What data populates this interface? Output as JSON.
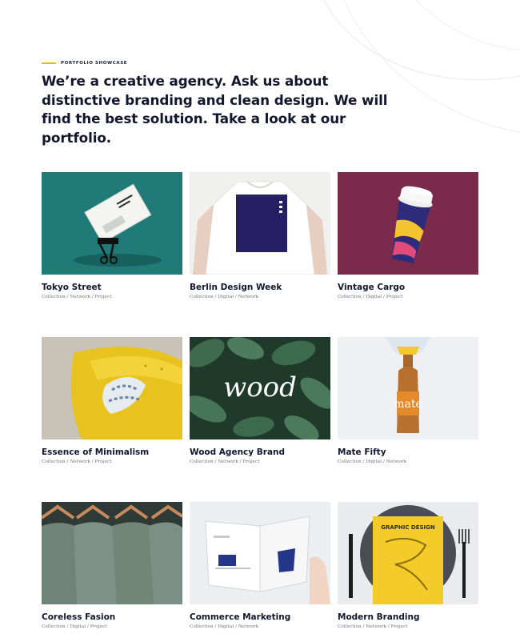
{
  "section": {
    "eyebrow": "PORTFOLIO SHOWCASE",
    "headline": "We’re a creative agency. Ask us about distinctive branding and clean design. We will find the best solution. Take a look at our portfolio."
  },
  "colors": {
    "accent": "#f0b41c",
    "heading": "#13172d",
    "meta": "#6e7180"
  },
  "portfolio": [
    {
      "title": "Tokyo Street",
      "meta": "Collection / Network / Project"
    },
    {
      "title": "Berlin Design Week",
      "meta": "Collection / Digital / Network"
    },
    {
      "title": "Vintage Cargo",
      "meta": "Collection / Digital / Project"
    },
    {
      "title": "Essence of Minimalism",
      "meta": "Collection / Network / Project"
    },
    {
      "title": "Wood Agency Brand",
      "meta": "Collection / Network / Project",
      "image_text": "wood"
    },
    {
      "title": "Mate Fifty",
      "meta": "Collection / Digital / Network",
      "image_text": "mate"
    },
    {
      "title": "Coreless Fasion",
      "meta": "Collection / Digital / Project"
    },
    {
      "title": "Commerce Marketing",
      "meta": "Collection / Digital / Network"
    },
    {
      "title": "Modern Branding",
      "meta": "Collection / Network / Project",
      "image_text": "GRAPHIC DESIGN"
    }
  ]
}
